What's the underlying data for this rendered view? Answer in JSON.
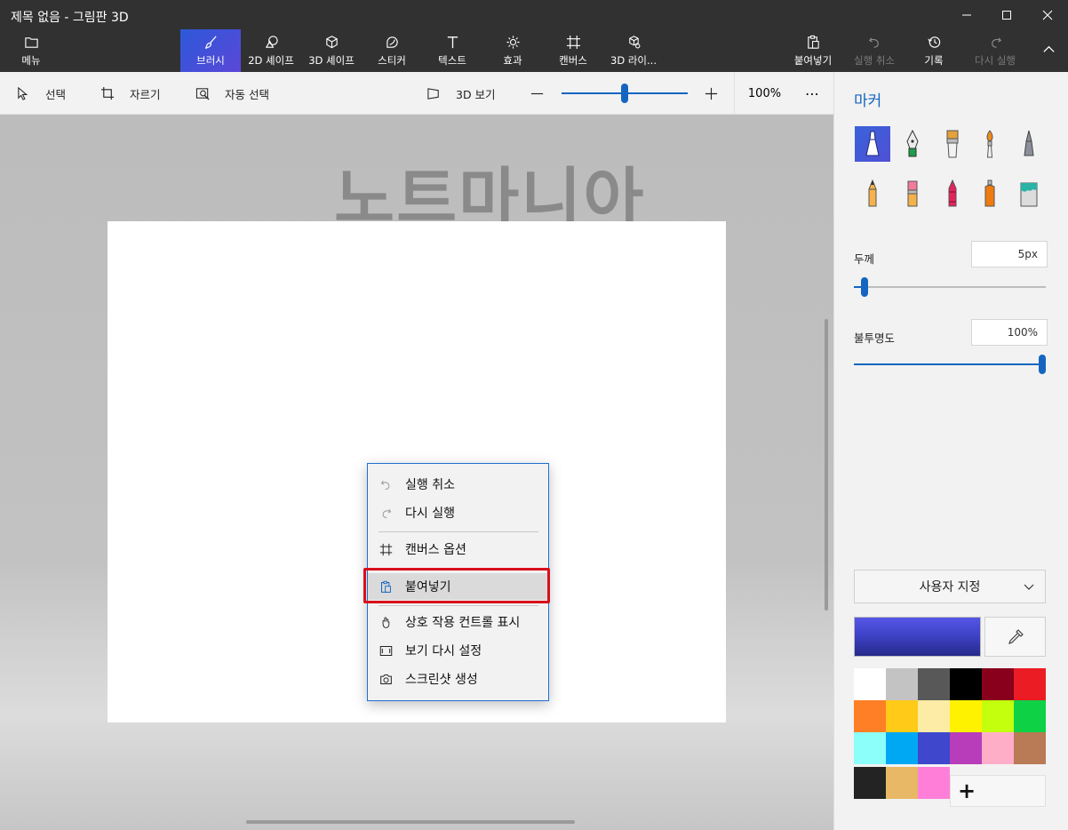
{
  "window": {
    "title": "제목 없음 - 그림판 3D"
  },
  "ribbon": {
    "menu": "메뉴",
    "tools": [
      "브러시",
      "2D 셰이프",
      "3D 셰이프",
      "스티커",
      "텍스트",
      "효과",
      "캔버스",
      "3D 라이..."
    ],
    "right": {
      "paste": "붙여넣기",
      "undo": "실행 취소",
      "history": "기록",
      "redo": "다시 실행"
    }
  },
  "toolbar": {
    "select": "선택",
    "crop": "자르기",
    "magic_select": "자동 선택",
    "view3d": "3D 보기",
    "zoom": "100%",
    "zoom_level": 0.5,
    "more": "⋯"
  },
  "workspace": {
    "watermark": "노트마니아"
  },
  "context_menu": {
    "items": [
      "실행 취소",
      "다시 실행",
      "캔버스 옵션",
      "붙여넣기",
      "상호 작용 컨트롤 표시",
      "보기 다시 설정",
      "스크린샷 생성"
    ],
    "highlighted": "붙여넣기"
  },
  "panel": {
    "title": "마커",
    "thickness_label": "두께",
    "thickness_value": "5px",
    "thickness_level": 0.03,
    "opacity_label": "불투명도",
    "opacity_value": "100%",
    "opacity_level": 1.0,
    "dropdown": "사용자 지정",
    "current_color": "#4a4fd8",
    "add_color": "+",
    "colors": [
      "#ffffff",
      "#c3c3c3",
      "#585858",
      "#000000",
      "#88001b",
      "#ec1c24",
      "#ff7f27",
      "#ffca18",
      "#fdeca6",
      "#fff200",
      "#c4ff0e",
      "#0ed145",
      "#8cfffb",
      "#00a8f3",
      "#3f48cc",
      "#b83dba",
      "#ffaec8",
      "#b97a56",
      "#232323",
      "#e8b866",
      "#ff7fd8"
    ]
  },
  "accent_color": "#1565c0"
}
